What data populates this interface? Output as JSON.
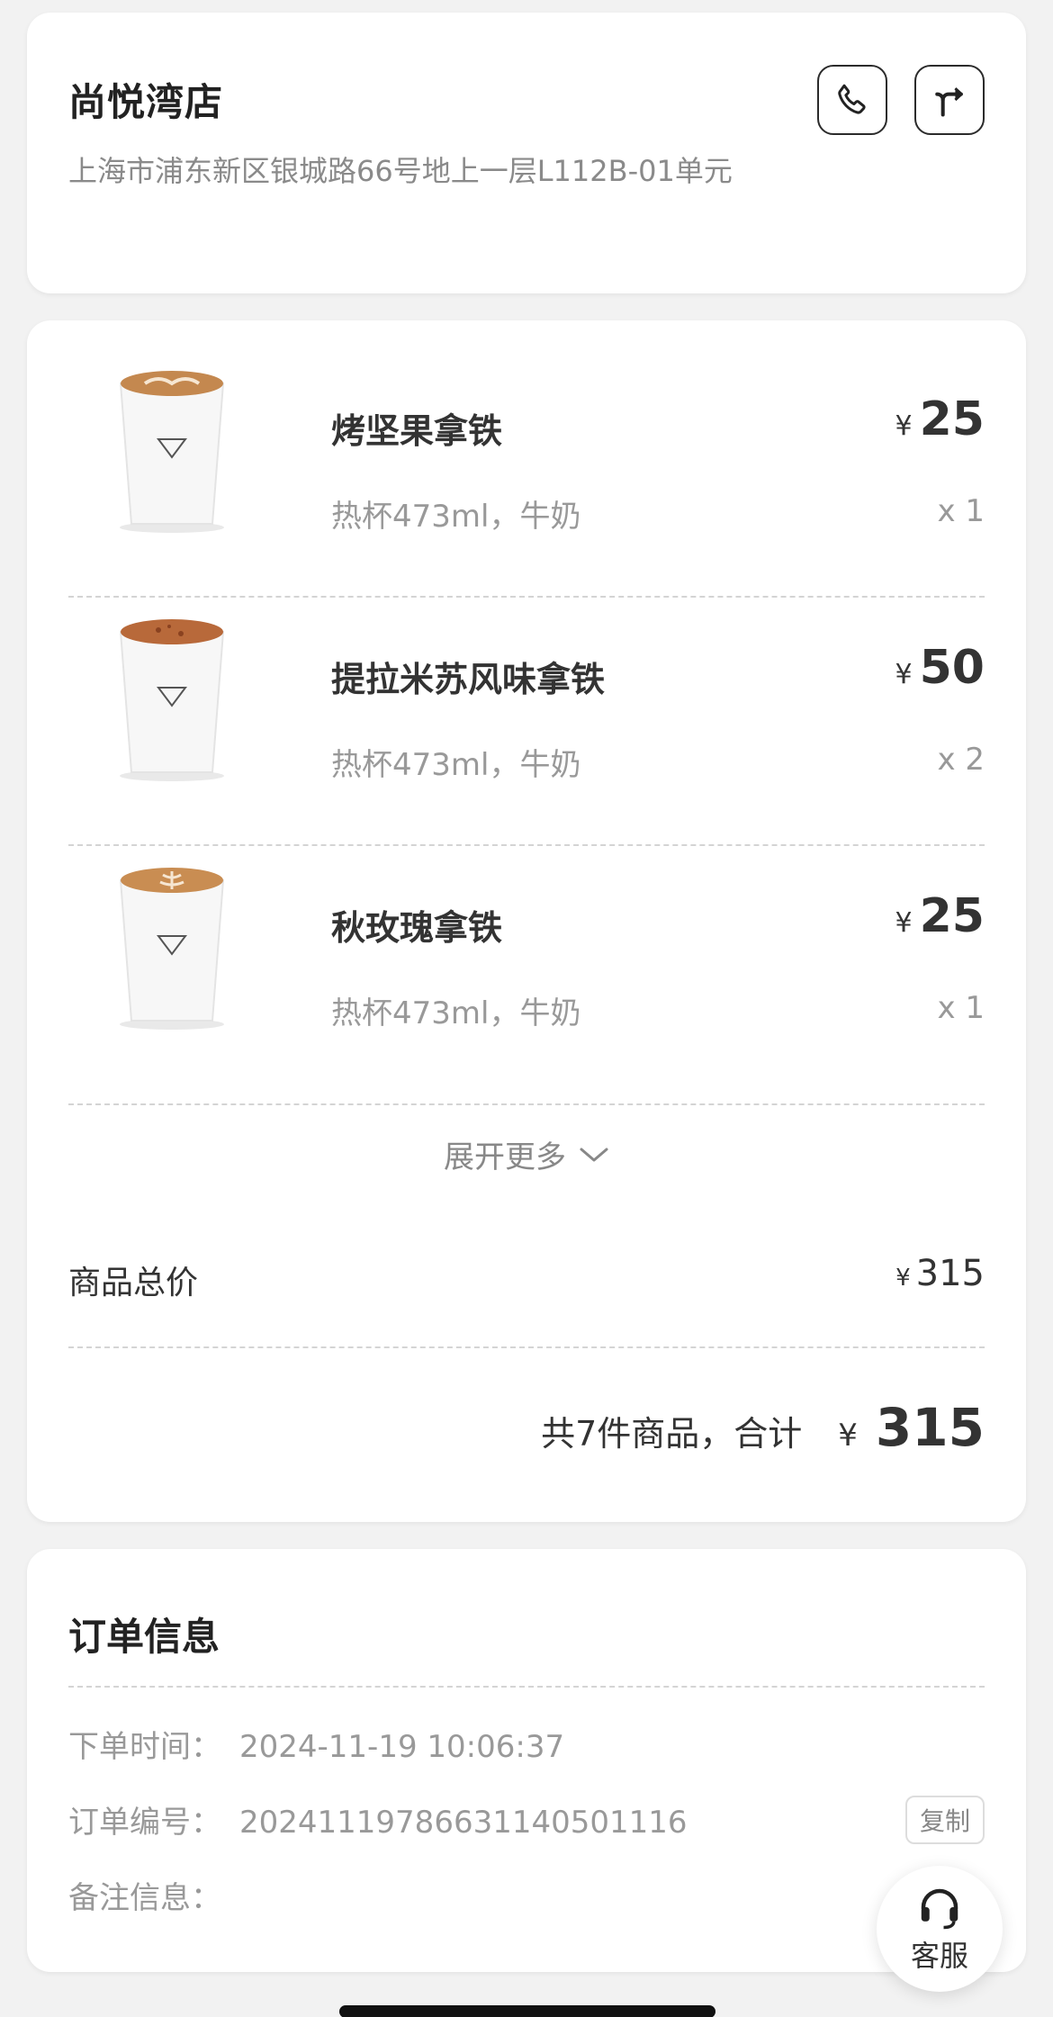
{
  "store": {
    "name": "尚悦湾店",
    "address": "上海市浦东新区银城路66号地上一层L112B-01单元",
    "phone_icon": "phone-icon",
    "nav_icon": "directions-icon"
  },
  "items": [
    {
      "name": "烤坚果拿铁",
      "spec": "热杯473ml，牛奶",
      "currency": "¥",
      "price": "25",
      "qty": "x 1"
    },
    {
      "name": "提拉米苏风味拿铁",
      "spec": "热杯473ml，牛奶",
      "currency": "¥",
      "price": "50",
      "qty": "x 2"
    },
    {
      "name": "秋玫瑰拿铁",
      "spec": "热杯473ml，牛奶",
      "currency": "¥",
      "price": "25",
      "qty": "x 1"
    }
  ],
  "expand_label": "展开更多",
  "subtotal": {
    "label": "商品总价",
    "currency": "¥",
    "value": "315"
  },
  "total": {
    "text": "共7件商品，合计",
    "currency": "¥",
    "value": "315"
  },
  "order_info": {
    "title": "订单信息",
    "time_label": "下单时间：",
    "time_value": "2024-11-19 10:06:37",
    "number_label": "订单编号：",
    "number_value": "20241119786631140501116",
    "copy_label": "复制",
    "note_label": "备注信息："
  },
  "service": {
    "label": "客服",
    "icon": "headset-icon"
  }
}
